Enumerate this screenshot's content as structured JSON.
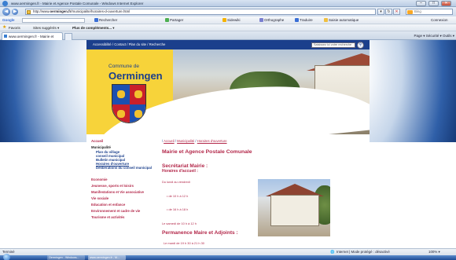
{
  "window": {
    "title": "www.oermingen.fr - Mairie et Agence Postale Comunale - Windows Internet Explorer",
    "btn_min": "–",
    "btn_max": "□",
    "btn_close": "✕"
  },
  "address_bar": {
    "back": "◀",
    "forward": "▶",
    "url_prefix": "http://www.",
    "url_bold": "oermingen.fr",
    "url_rest": "/municipalite/horaires-d-ouverture.html",
    "search_engine": "Bing"
  },
  "google_toolbar": {
    "label": "Google",
    "items": [
      "Rechercher",
      "Partager",
      "Sidewiki",
      "Orthographe",
      "Traduire",
      "Saisie automatique"
    ],
    "right": "Connexion"
  },
  "favorites_bar": {
    "favorites": "Favoris",
    "items": [
      "Sites suggérés ▾",
      "Plus de compléments... ▾"
    ]
  },
  "tab": {
    "title": "www.oermingen.fr - Mairie et Agence Postale Co...",
    "commands": "Page ▾  Sécurité ▾  Outils ▾"
  },
  "site": {
    "topnav": "Accessibilité  /  Contact  /  Plan du site  /  Recherche",
    "search_placeholder": "Saisissez ici votre recherche",
    "commune_label": "Commune de",
    "commune_name": "Oermingen"
  },
  "sidebar": {
    "cat_accueil": "Accueil",
    "cat_municipalite": "Municipalité",
    "sub": [
      "Plan du village",
      "conseil municipal",
      "Bulletin municipal",
      "Horaires d'ouverture",
      "Délibérations du conseil municipal"
    ],
    "others": [
      "Economie",
      "Jeunesse, sports et loisirs",
      "Manifestations et Vie associative",
      "Vie sociale",
      "Education et enfance",
      "Environnement et cadre de vie",
      "Tourisme et activités"
    ]
  },
  "main": {
    "breadcrumb_1": "Accueil",
    "breadcrumb_2": "Municipalité",
    "breadcrumb_3": "Horaires d'ouverture",
    "title": "Mairie et Agence Postale Comunale",
    "section1": "Secrétariat Mairie :",
    "subsection1": "Horaires d'accueil :",
    "line_days": "Du lundi au vendredi",
    "line_am": "de 10 h à 12 h",
    "line_pm": "de 16 h à 18 h",
    "line_sat": "Le samedi de 10 h à 12 h",
    "section2": "Permanence Maire et Adjoints :",
    "line_mardi": "Le mardi de 19 h 30 à 21 h 30"
  },
  "status": {
    "left": "Terminé",
    "zone": "Internet | Mode protégé : désactivé",
    "zoom": "100% ▾"
  },
  "taskbar": {
    "items": [
      "Oermingen - Windows...",
      "www.oermingen.fr - M..."
    ]
  }
}
